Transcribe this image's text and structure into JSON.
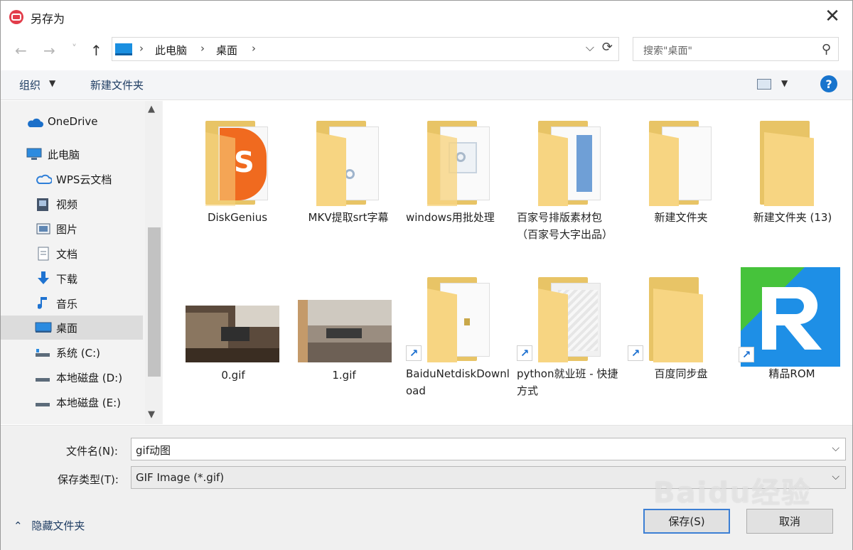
{
  "window": {
    "title": "另存为",
    "close": "✕"
  },
  "nav": {
    "back": "←",
    "forward": "→",
    "recent": "˅",
    "up": "↑"
  },
  "address": {
    "crumbs": [
      "此电脑",
      "桌面"
    ],
    "separator": "›",
    "dropdown": "⌵",
    "refresh": "⟳"
  },
  "search": {
    "placeholder": "搜索\"桌面\""
  },
  "toolbar": {
    "organize_label": "组织",
    "new_folder_label": "新建文件夹",
    "help_label": "?"
  },
  "sidebar": {
    "items": [
      {
        "label": "OneDrive",
        "icon": "cloud-icon"
      },
      {
        "label": "此电脑",
        "icon": "computer-icon"
      },
      {
        "label": "WPS云文档",
        "icon": "wps-cloud-icon"
      },
      {
        "label": "视频",
        "icon": "video-icon"
      },
      {
        "label": "图片",
        "icon": "pictures-icon"
      },
      {
        "label": "文档",
        "icon": "documents-icon"
      },
      {
        "label": "下载",
        "icon": "download-icon"
      },
      {
        "label": "音乐",
        "icon": "music-icon"
      },
      {
        "label": "桌面",
        "icon": "desktop-icon",
        "selected": true
      },
      {
        "label": "系统 (C:)",
        "icon": "drive-icon"
      },
      {
        "label": "本地磁盘 (D:)",
        "icon": "drive-icon"
      },
      {
        "label": "本地磁盘 (E:)",
        "icon": "drive-icon"
      }
    ]
  },
  "files": [
    {
      "name": "DiskGenius",
      "type": "folder"
    },
    {
      "name": "MKV提取srt字幕",
      "type": "folder"
    },
    {
      "name": "windows用批处理",
      "type": "folder"
    },
    {
      "name": "百家号排版素材包（百家号大字出品）",
      "type": "folder"
    },
    {
      "name": "新建文件夹",
      "type": "folder"
    },
    {
      "name": "新建文件夹 (13)",
      "type": "folder"
    },
    {
      "name": "0.gif",
      "type": "image"
    },
    {
      "name": "1.gif",
      "type": "image"
    },
    {
      "name": "BaiduNetdiskDownload",
      "type": "folder-shortcut"
    },
    {
      "name": "python就业班 - 快捷方式",
      "type": "folder-shortcut"
    },
    {
      "name": "百度同步盘",
      "type": "folder-shortcut"
    },
    {
      "name": "精品ROM",
      "type": "app-shortcut"
    }
  ],
  "form": {
    "filename_label": "文件名(N):",
    "filename_value": "gif动图",
    "filetype_label": "保存类型(T):",
    "filetype_value": "GIF Image (*.gif)",
    "dropdown_arrow": "⌵",
    "hide_folders_label": "隐藏文件夹",
    "save_label": "保存(S)",
    "cancel_label": "取消"
  },
  "watermark": "Baidu经验",
  "colors": {
    "accent": "#1874cd",
    "folder": "#e8c466",
    "selected": "#dcdcdc"
  }
}
